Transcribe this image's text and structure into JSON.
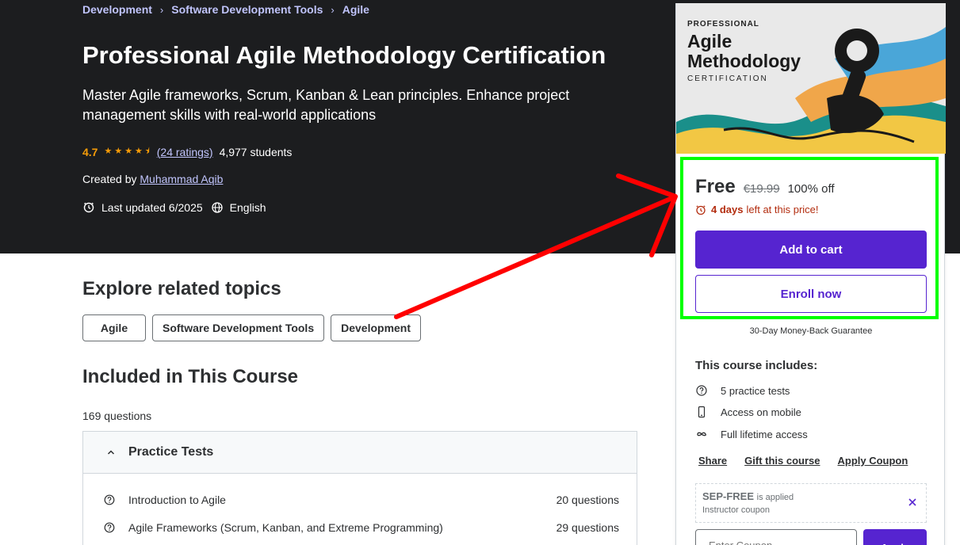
{
  "colors": {
    "hero_bg": "#1c1d1f",
    "accent": "#5624d0",
    "link": "#c0c4fc",
    "rating": "#f69c08",
    "urgent": "#b32d0f",
    "highlight": "#00ff00",
    "annotation_arrow": "#ff0000"
  },
  "breadcrumb": {
    "items": [
      "Development",
      "Software Development Tools",
      "Agile"
    ],
    "separator_icon": "chevron-right-icon"
  },
  "course": {
    "title": "Professional Agile Methodology Certification",
    "subtitle": "Master Agile frameworks, Scrum, Kanban & Lean principles. Enhance project management skills with real-world applications",
    "rating": "4.7",
    "stars": "★★★★⯨",
    "rating_value": 4.7,
    "ratings_count": "(24 ratings)",
    "students": "4,977 students",
    "created_by_label": "Created by",
    "author": "Muhammad Aqib",
    "last_updated": "Last updated 6/2025",
    "language": "English"
  },
  "related": {
    "title": "Explore related topics",
    "topics": [
      "Agile",
      "Software Development Tools",
      "Development"
    ]
  },
  "included": {
    "title": "Included in This Course",
    "questions_count": "169 questions",
    "section_title": "Practice Tests",
    "lessons": [
      {
        "name": "Introduction to Agile",
        "questions": "20 questions"
      },
      {
        "name": "Agile Frameworks (Scrum, Kanban, and Extreme Programming)",
        "questions": "29 questions"
      }
    ]
  },
  "sidebar": {
    "thumbnail": {
      "line1": "PROFESSIONAL",
      "line2": "Agile",
      "line3": "Methodology",
      "line4": "CERTIFICATION"
    },
    "price": "Free",
    "original_price": "€19.99",
    "discount": "100% off",
    "timer_bold": "4 days",
    "timer_rest": "left at this price!",
    "add_to_cart": "Add to cart",
    "enroll_now": "Enroll now",
    "guarantee": "30-Day Money-Back Guarantee",
    "includes_title": "This course includes:",
    "includes": [
      {
        "icon": "question-circle-icon",
        "label": "5 practice tests"
      },
      {
        "icon": "mobile-icon",
        "label": "Access on mobile"
      },
      {
        "icon": "infinity-icon",
        "label": "Full lifetime access"
      }
    ],
    "links": [
      "Share",
      "Gift this course",
      "Apply Coupon"
    ],
    "coupon": {
      "code": "SEP-FREE",
      "applied_text": "is applied",
      "type": "Instructor coupon"
    },
    "coupon_placeholder": "Enter Coupon",
    "apply_label": "Apply"
  }
}
